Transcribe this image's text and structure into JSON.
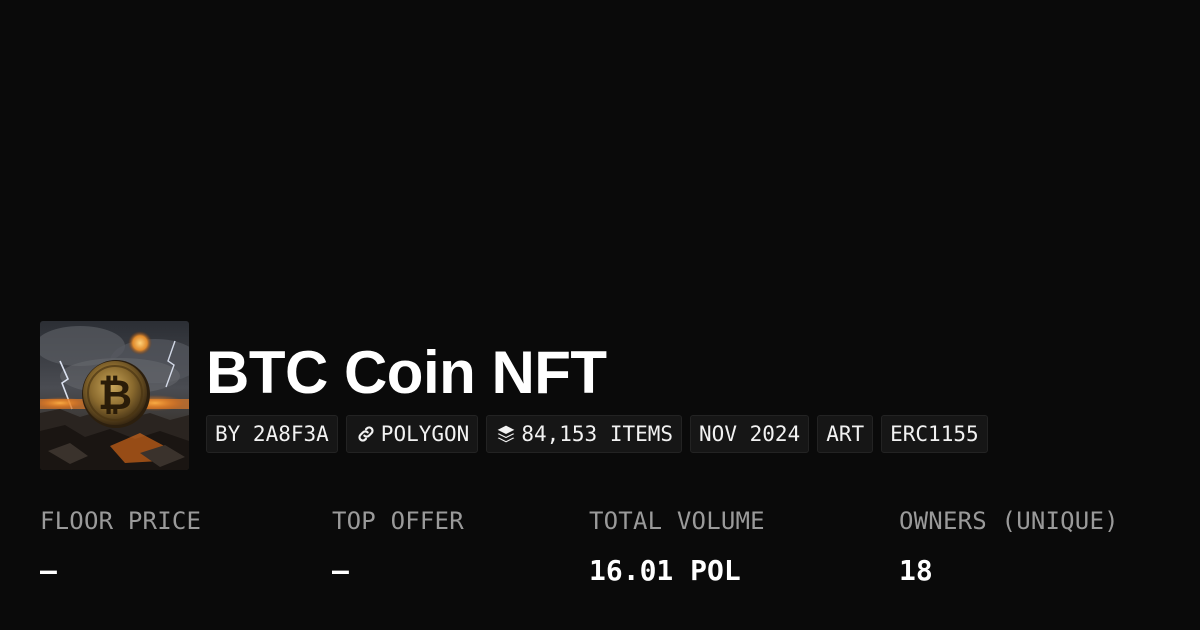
{
  "collection": {
    "title": "BTC Coin NFT",
    "chips": [
      {
        "label": "BY 2A8F3A",
        "icon": ""
      },
      {
        "label": "POLYGON",
        "icon": "link-icon"
      },
      {
        "label": "84,153 ITEMS",
        "icon": "layers-icon"
      },
      {
        "label": "NOV 2024",
        "icon": ""
      },
      {
        "label": "ART",
        "icon": ""
      },
      {
        "label": "ERC1155",
        "icon": ""
      }
    ]
  },
  "stats": [
    {
      "label": "FLOOR PRICE",
      "value": "—"
    },
    {
      "label": "TOP OFFER",
      "value": "—"
    },
    {
      "label": "TOTAL VOLUME",
      "value": "16.01 POL"
    },
    {
      "label": "OWNERS (UNIQUE)",
      "value": "18"
    }
  ],
  "colors": {
    "background": "#0a0a0a",
    "chip_background": "#161616",
    "chip_border": "#232323",
    "label": "#9a9a9a",
    "value": "#ffffff"
  }
}
